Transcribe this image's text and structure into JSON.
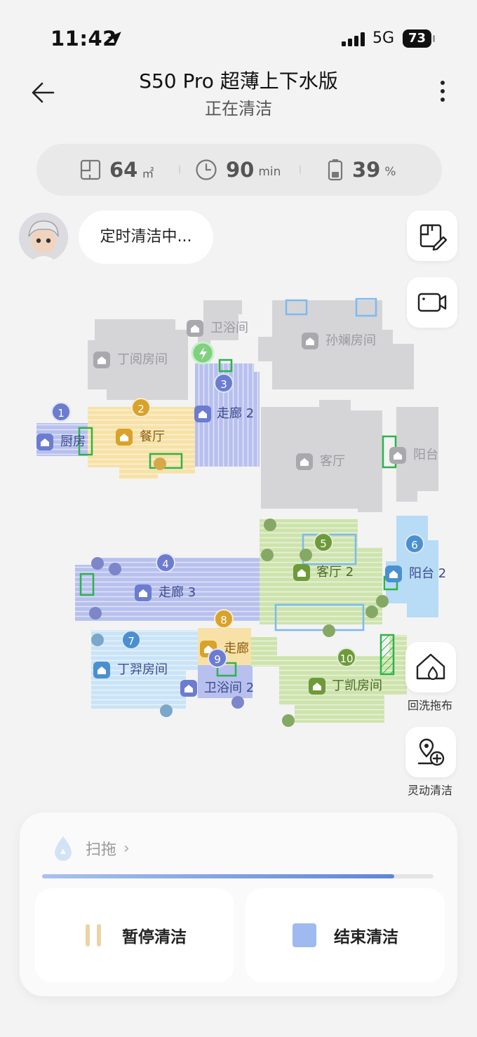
{
  "status_bar": {
    "time": "11:42",
    "network": "5G",
    "battery": "73"
  },
  "header": {
    "title": "S50 Pro 超薄上下水版",
    "subtitle": "正在清洁"
  },
  "stats": {
    "area": {
      "value": "64",
      "unit": "㎡"
    },
    "time": {
      "value": "90",
      "unit": "min"
    },
    "battery": {
      "value": "39",
      "unit": "%"
    }
  },
  "status_bubble": "定时清洁中...",
  "side_actions": {
    "mop_wash": "回洗拖布",
    "smart_clean": "灵动清洁"
  },
  "map": {
    "rooms": [
      {
        "name": "卫浴间",
        "active": false
      },
      {
        "name": "丁阅房间",
        "active": false
      },
      {
        "name": "孙斓房间",
        "active": false
      },
      {
        "name": "客厅",
        "active": false
      },
      {
        "name": "阳台",
        "active": false
      },
      {
        "name": "厨房",
        "number": "1",
        "active": true,
        "color": "#6b7cd1"
      },
      {
        "name": "餐厅",
        "number": "2",
        "active": true,
        "color": "#d9a22a"
      },
      {
        "name": "走廊 2",
        "number": "3",
        "active": true,
        "color": "#6b7cd1"
      },
      {
        "name": "走廊 3",
        "number": "4",
        "active": true,
        "color": "#6b7cd1"
      },
      {
        "name": "客厅 2",
        "number": "5",
        "active": true,
        "color": "#6e9a3a"
      },
      {
        "name": "阳台 2",
        "number": "6",
        "active": true,
        "color": "#4a90d0"
      },
      {
        "name": "丁羿房间",
        "number": "7",
        "active": true,
        "color": "#4a90d0"
      },
      {
        "name": "走廊",
        "number": "8",
        "active": true,
        "color": "#d9a22a"
      },
      {
        "name": "卫浴间 2",
        "number": "9",
        "active": true,
        "color": "#6b7cd1"
      },
      {
        "name": "丁凯房间",
        "number": "10",
        "active": true,
        "color": "#6e9a3a"
      }
    ]
  },
  "panel": {
    "mode_label": "扫拖",
    "progress": 0.9,
    "pause_label": "暂停清洁",
    "stop_label": "结束清洁"
  },
  "colors": {
    "accent_blue": "#6b8fdc",
    "pause_icon": "#e8cfa0",
    "stop_icon": "#8eaef0",
    "room_gray": "#d5d5d7"
  }
}
